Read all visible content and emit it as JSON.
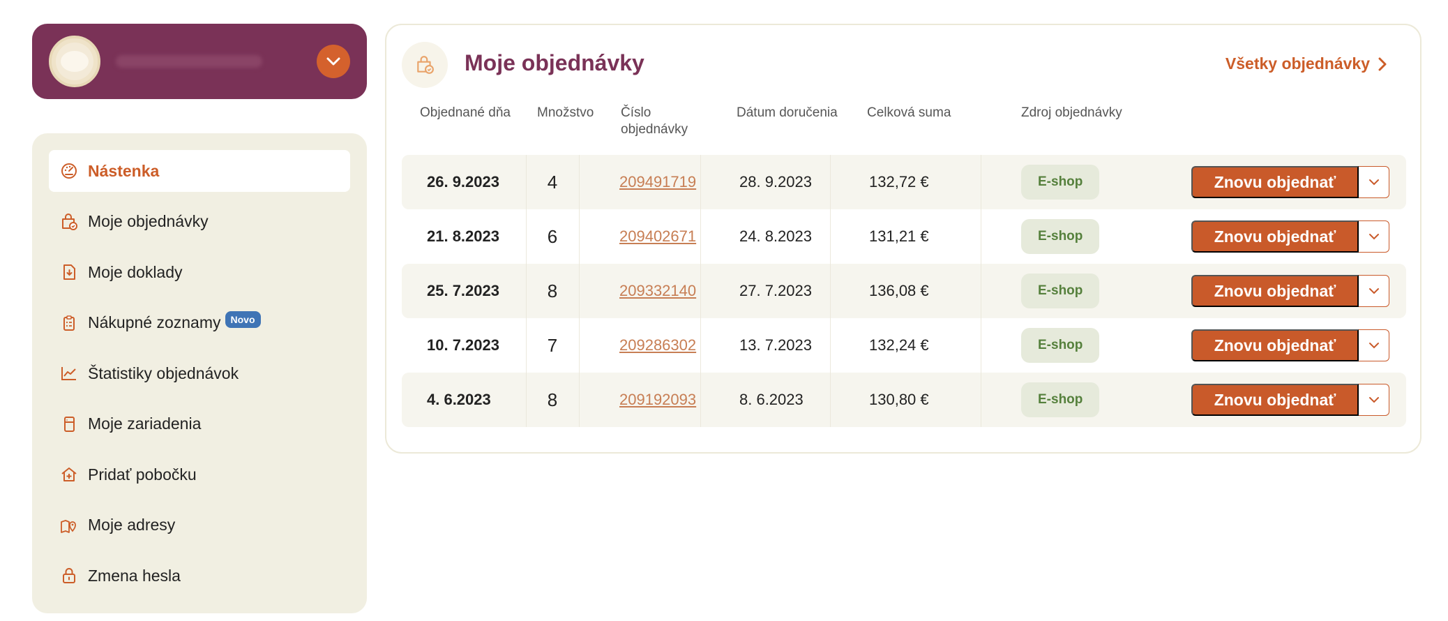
{
  "user": {
    "avatar_icon": "avatar-logo-icon",
    "toggle_icon": "chevron-down-icon"
  },
  "colors": {
    "brand_plum": "#7a3257",
    "accent_orange": "#c95a2a",
    "sidebar_bg": "#f1efe2",
    "badge_blue": "#3f74b5",
    "eshop_green": "#55803c"
  },
  "sidebar": {
    "items": [
      {
        "label": "Nástenka",
        "icon": "dashboard-icon",
        "active": true
      },
      {
        "label": "Moje objednávky",
        "icon": "shopping-bag-icon"
      },
      {
        "label": "Moje doklady",
        "icon": "document-download-icon"
      },
      {
        "label": "Nákupné zoznamy",
        "icon": "clipboard-list-icon",
        "badge": "Novo"
      },
      {
        "label": "Štatistiky objednávok",
        "icon": "line-chart-icon"
      },
      {
        "label": "Moje zariadenia",
        "icon": "device-icon"
      },
      {
        "label": "Pridať pobočku",
        "icon": "add-branch-icon"
      },
      {
        "label": "Moje adresy",
        "icon": "map-pin-icon"
      },
      {
        "label": "Zmena hesla",
        "icon": "lock-icon"
      }
    ]
  },
  "orders": {
    "title": "Moje objednávky",
    "icon": "shopping-bag-icon",
    "all_link": "Všetky objednávky",
    "columns": {
      "ordered": "Objednané dňa",
      "quantity": "Množstvo",
      "number_line1": "Číslo",
      "number_line2": "objednávky",
      "delivery": "Dátum doručenia",
      "total": "Celková suma",
      "source": "Zdroj objednávky"
    },
    "reorder_label": "Znovu objednať",
    "rows": [
      {
        "ordered": "26. 9.2023",
        "quantity": "4",
        "number": "209491719",
        "delivery": "28. 9.2023",
        "total": "132,72 €",
        "source": "E-shop"
      },
      {
        "ordered": "21. 8.2023",
        "quantity": "6",
        "number": "209402671",
        "delivery": "24. 8.2023",
        "total": "131,21 €",
        "source": "E-shop"
      },
      {
        "ordered": "25. 7.2023",
        "quantity": "8",
        "number": "209332140",
        "delivery": "27. 7.2023",
        "total": "136,08 €",
        "source": "E-shop"
      },
      {
        "ordered": "10. 7.2023",
        "quantity": "7",
        "number": "209286302",
        "delivery": "13. 7.2023",
        "total": "132,24 €",
        "source": "E-shop"
      },
      {
        "ordered": "4. 6.2023",
        "quantity": "8",
        "number": "209192093",
        "delivery": "8. 6.2023",
        "total": "130,80 €",
        "source": "E-shop"
      }
    ]
  }
}
